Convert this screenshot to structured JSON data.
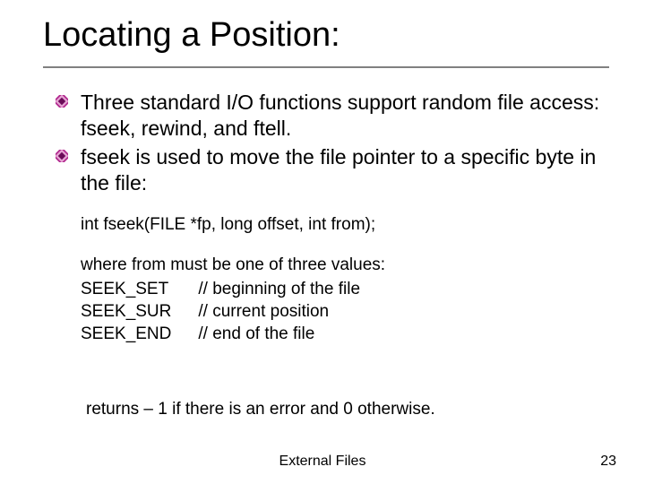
{
  "title": "Locating a Position:",
  "bullets": [
    " Three standard I/O functions support random file access: fseek, rewind, and ftell.",
    " fseek is used to move the file pointer to a specific byte in the file:"
  ],
  "signature": "int fseek(FILE *fp, long offset, int from);",
  "from_intro": "where from must be one of three values:",
  "seek": [
    {
      "name": "SEEK_SET",
      "comment": "// beginning of the file"
    },
    {
      "name": "SEEK_SUR",
      "comment": "// current position"
    },
    {
      "name": "SEEK_END",
      "comment": "// end of the file"
    }
  ],
  "returns": "returns – 1 if there is an error and 0 otherwise.",
  "footer": {
    "center": "External Files",
    "page": "23"
  }
}
